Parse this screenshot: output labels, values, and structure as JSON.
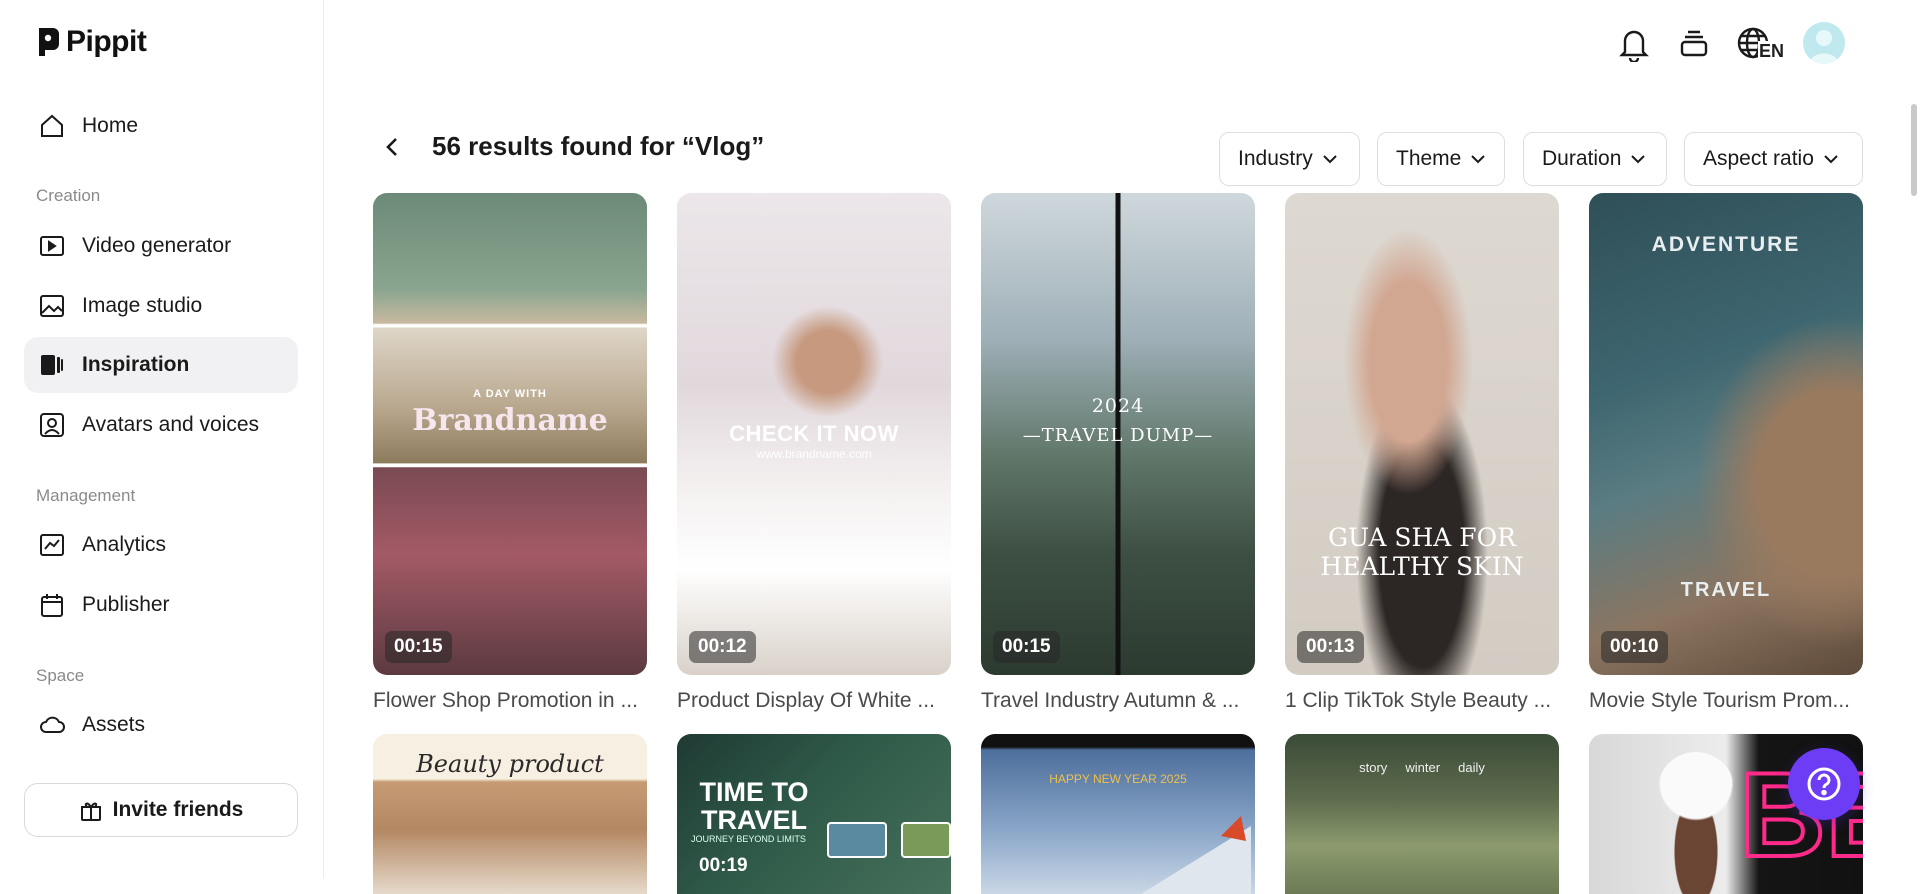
{
  "brand": {
    "name": "Pippit"
  },
  "sidebar": {
    "home": "Home",
    "creation_label": "Creation",
    "video_generator": "Video generator",
    "image_studio": "Image studio",
    "inspiration": "Inspiration",
    "avatars": "Avatars and voices",
    "management_label": "Management",
    "analytics": "Analytics",
    "publisher": "Publisher",
    "space_label": "Space",
    "assets": "Assets",
    "invite": "Invite friends"
  },
  "topbar": {
    "language": "EN"
  },
  "header": {
    "results": "56 results found for “Vlog”"
  },
  "filters": [
    "Industry",
    "Theme",
    "Duration",
    "Aspect ratio"
  ],
  "cards": [
    {
      "title": "Flower Shop Promotion in ...",
      "duration": "00:15",
      "overlay_small": "A DAY WITH",
      "overlay_big": "Brandname"
    },
    {
      "title": "Product Display Of White ...",
      "duration": "00:12",
      "overlay_big": "CHECK IT NOW",
      "overlay_small": "www.brandname.com"
    },
    {
      "title": "Travel Industry Autumn & ...",
      "duration": "00:15",
      "overlay_small": "2024",
      "overlay_big": "—TRAVEL DUMP—"
    },
    {
      "title": "1 Clip TikTok Style Beauty ...",
      "duration": "00:13",
      "overlay_big": "GUA SHA FOR",
      "overlay_big2": "HEALTHY SKIN"
    },
    {
      "title": "Movie Style Tourism Prom...",
      "duration": "00:10",
      "overlay_small": "ADVENTURE",
      "overlay_big": "TRAVEL"
    }
  ],
  "cards_row2": [
    {
      "overlay": "Beauty product"
    },
    {
      "duration": "00:19",
      "overlay": "TIME TO TRAVEL",
      "overlay_small": "JOURNEY BEYOND LIMITS"
    },
    {
      "overlay": "HAPPY NEW YEAR 2025"
    },
    {
      "overlay": "story     winter     daily"
    },
    {
      "overlay": "BE"
    }
  ],
  "colors": {
    "accent": "#6d3df5",
    "active_bg": "#f1f1f3"
  }
}
